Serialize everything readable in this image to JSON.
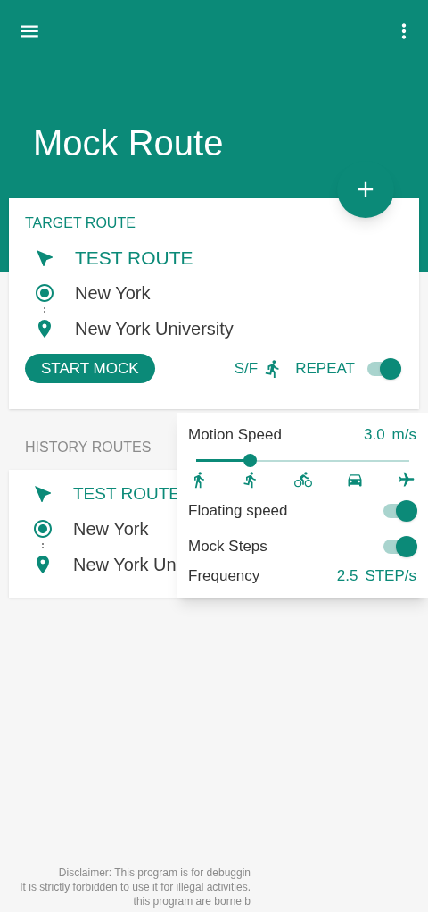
{
  "app_bar": {
    "title": "Mock Route"
  },
  "target_route": {
    "heading": "TARGET ROUTE",
    "name": "TEST ROUTE",
    "start": "New York",
    "end": "New York University",
    "start_button": "START MOCK",
    "sf_label": "S/F",
    "repeat_label": "REPEAT",
    "repeat_on": true
  },
  "history": {
    "heading": "HISTORY ROUTES",
    "routes": [
      {
        "name": "TEST ROUTE",
        "start": "New York",
        "end": "New York Un"
      }
    ]
  },
  "speed_panel": {
    "label": "Motion Speed",
    "value": "3.0",
    "unit": "m/s",
    "level": 0.25,
    "modes": [
      {
        "kind": "walk"
      },
      {
        "kind": "run"
      },
      {
        "kind": "bike"
      },
      {
        "kind": "car"
      },
      {
        "kind": "plane"
      }
    ],
    "floating_speed": {
      "label": "Floating speed",
      "on": true
    },
    "mock_steps": {
      "label": "Mock Steps",
      "on": true
    },
    "frequency": {
      "label": "Frequency",
      "value": "2.5",
      "unit": "STEP/s"
    }
  },
  "disclaimer": [
    "Disclaimer: This program is for debuggin",
    "It is strictly forbidden to use it for illegal activities.",
    "this program are borne b"
  ]
}
